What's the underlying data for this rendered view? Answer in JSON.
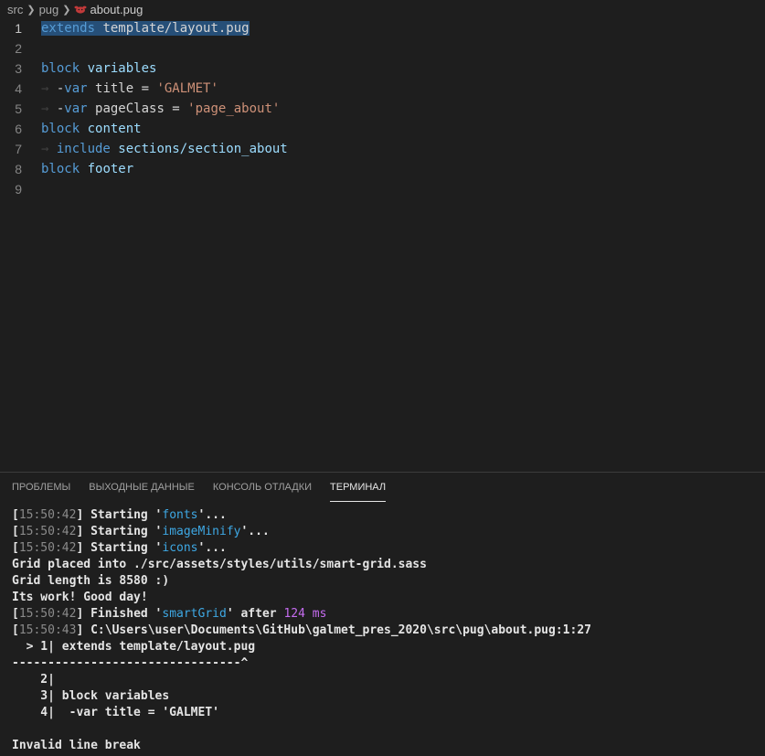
{
  "breadcrumb": {
    "items": [
      "src",
      "pug",
      "about.pug"
    ],
    "file_icon": "pug-dog-icon"
  },
  "editor": {
    "lines": [
      {
        "num": "1",
        "tokens": [
          {
            "t": "extends",
            "c": "kw"
          },
          {
            "t": " template/layout.pug",
            "c": "plain"
          }
        ],
        "selected": true
      },
      {
        "num": "2",
        "tokens": []
      },
      {
        "num": "3",
        "tokens": [
          {
            "t": "block",
            "c": "kw"
          },
          {
            "t": " variables",
            "c": "id"
          }
        ]
      },
      {
        "num": "4",
        "indent": true,
        "tokens": [
          {
            "t": "-",
            "c": "plain"
          },
          {
            "t": "var",
            "c": "kw"
          },
          {
            "t": " title = ",
            "c": "plain"
          },
          {
            "t": "'GALMET'",
            "c": "str"
          }
        ]
      },
      {
        "num": "5",
        "indent": true,
        "tokens": [
          {
            "t": "-",
            "c": "plain"
          },
          {
            "t": "var",
            "c": "kw"
          },
          {
            "t": " pageClass = ",
            "c": "plain"
          },
          {
            "t": "'page_about'",
            "c": "str"
          }
        ]
      },
      {
        "num": "6",
        "tokens": [
          {
            "t": "block",
            "c": "kw"
          },
          {
            "t": " content",
            "c": "id"
          }
        ]
      },
      {
        "num": "7",
        "indent": true,
        "tokens": [
          {
            "t": "include",
            "c": "kw"
          },
          {
            "t": " sections/section_about",
            "c": "id"
          }
        ]
      },
      {
        "num": "8",
        "tokens": [
          {
            "t": "block",
            "c": "kw"
          },
          {
            "t": " footer",
            "c": "id"
          }
        ]
      },
      {
        "num": "9",
        "tokens": []
      }
    ]
  },
  "panel": {
    "tabs": [
      "ПРОБЛЕМЫ",
      "ВЫХОДНЫЕ ДАННЫЕ",
      "КОНСОЛЬ ОТЛАДКИ",
      "ТЕРМИНАЛ"
    ],
    "active_tab": 3
  },
  "terminal": {
    "lines": [
      [
        {
          "t": "[",
          "c": ""
        },
        {
          "t": "15:50:42",
          "c": "ts"
        },
        {
          "t": "] Starting '",
          "c": ""
        },
        {
          "t": "fonts",
          "c": "task"
        },
        {
          "t": "'...",
          "c": ""
        }
      ],
      [
        {
          "t": "[",
          "c": ""
        },
        {
          "t": "15:50:42",
          "c": "ts"
        },
        {
          "t": "] Starting '",
          "c": ""
        },
        {
          "t": "imageMinify",
          "c": "task"
        },
        {
          "t": "'...",
          "c": ""
        }
      ],
      [
        {
          "t": "[",
          "c": ""
        },
        {
          "t": "15:50:42",
          "c": "ts"
        },
        {
          "t": "] Starting '",
          "c": ""
        },
        {
          "t": "icons",
          "c": "task"
        },
        {
          "t": "'...",
          "c": ""
        }
      ],
      [
        {
          "t": "Grid placed into ./src/assets/styles/utils/smart-grid.sass",
          "c": ""
        }
      ],
      [
        {
          "t": "Grid length is 8580 :)",
          "c": ""
        }
      ],
      [
        {
          "t": "Its work! Good day!",
          "c": ""
        }
      ],
      [
        {
          "t": "[",
          "c": ""
        },
        {
          "t": "15:50:42",
          "c": "ts"
        },
        {
          "t": "] Finished '",
          "c": ""
        },
        {
          "t": "smartGrid",
          "c": "task"
        },
        {
          "t": "' after ",
          "c": ""
        },
        {
          "t": "124 ms",
          "c": "ms"
        }
      ],
      [
        {
          "t": "[",
          "c": ""
        },
        {
          "t": "15:50:43",
          "c": "ts"
        },
        {
          "t": "] C:\\Users\\user\\Documents\\GitHub\\galmet_pres_2020\\src\\pug\\about.pug:1:27",
          "c": ""
        }
      ],
      [
        {
          "t": "  > 1| extends template/layout.pug",
          "c": ""
        }
      ],
      [
        {
          "t": "--------------------------------^",
          "c": ""
        }
      ],
      [
        {
          "t": "    2|",
          "c": ""
        }
      ],
      [
        {
          "t": "    3| block variables",
          "c": ""
        }
      ],
      [
        {
          "t": "    4|  -var title = 'GALMET'",
          "c": ""
        }
      ],
      [
        {
          "t": "",
          "c": ""
        }
      ],
      [
        {
          "t": "Invalid line break",
          "c": ""
        }
      ]
    ]
  },
  "colors": {
    "background": "#1e1e1e",
    "keyword": "#569cd6",
    "identifier": "#9cdcfe",
    "string": "#ce9178",
    "selection": "#264f78",
    "task_name": "#3ea8e4",
    "duration": "#c56cf0"
  }
}
